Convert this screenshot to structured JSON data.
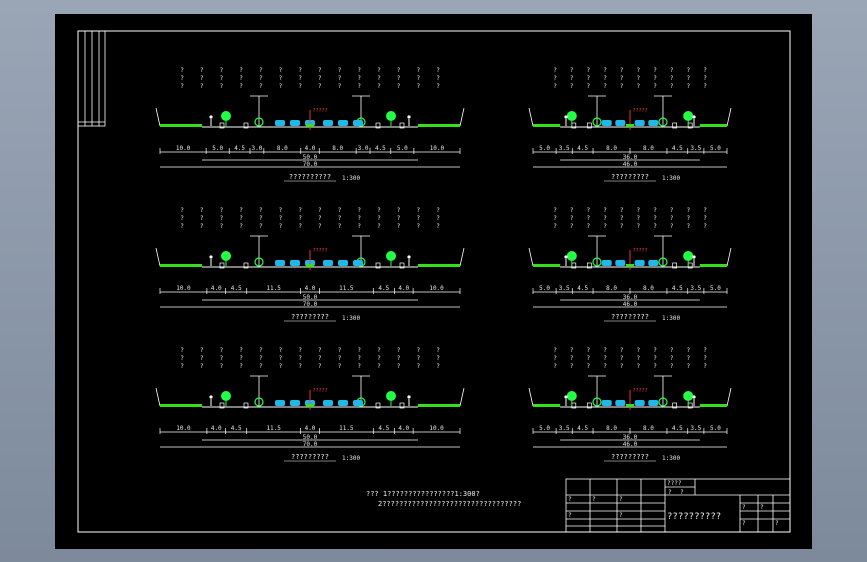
{
  "colors": {
    "background": "#000000",
    "frame": "#ffffff",
    "ground": "#33e01a",
    "tree": "#22ff44",
    "vehicle": "#1fb8e8",
    "centerline": "#ff3b3b",
    "text": "#f0f0f0"
  },
  "sections": [
    {
      "id": "left-1",
      "dims": [
        "10.0",
        "5.0",
        "4.5",
        "3.0",
        "8.0",
        "4.0",
        "8.0",
        "3.0",
        "4.5",
        "5.0",
        "10.0"
      ],
      "total_inner": "50.0",
      "total_outer": "70.0",
      "caption": "??????????",
      "scale": "1:300",
      "center_label": "?????"
    },
    {
      "id": "left-2",
      "dims": [
        "10.0",
        "4.0",
        "4.5",
        "11.5",
        "4.0",
        "11.5",
        "4.5",
        "4.0",
        "10.0"
      ],
      "total_inner": "50.0",
      "total_outer": "70.0",
      "caption": "?????????",
      "scale": "1:300",
      "center_label": "?????"
    },
    {
      "id": "left-3",
      "dims": [
        "10.0",
        "4.0",
        "4.5",
        "11.5",
        "4.0",
        "11.5",
        "4.5",
        "4.0",
        "10.0"
      ],
      "total_inner": "50.0",
      "total_outer": "70.0",
      "caption": "?????????",
      "scale": "1:300",
      "center_label": "?????"
    },
    {
      "id": "right-1",
      "dims": [
        "5.0",
        "3.5",
        "4.5",
        "8.0",
        "8.0",
        "4.5",
        "3.5",
        "5.0"
      ],
      "total_inner": "36.0",
      "total_outer": "46.0",
      "caption": "?????????",
      "scale": "1:300",
      "center_label": "?????"
    },
    {
      "id": "right-2",
      "dims": [
        "5.0",
        "3.5",
        "4.5",
        "8.0",
        "8.0",
        "4.5",
        "3.5",
        "5.0"
      ],
      "total_inner": "36.0",
      "total_outer": "46.0",
      "caption": "?????????",
      "scale": "1:300",
      "center_label": "?????"
    },
    {
      "id": "right-3",
      "dims": [
        "5.0",
        "3.5",
        "4.5",
        "8.0",
        "8.0",
        "4.5",
        "3.5",
        "5.0"
      ],
      "total_inner": "36.0",
      "total_outer": "46.0",
      "caption": "?????????",
      "scale": "1:300",
      "center_label": "?????"
    }
  ],
  "notes": [
    "??? 1????????????????1:300?",
    "2?????????????????????????????????"
  ],
  "title_block": {
    "title": "??????????",
    "cells": [
      "????",
      "?",
      "?",
      "?",
      "?",
      "?",
      "?",
      "?",
      "?",
      "?",
      "?",
      "?"
    ]
  }
}
